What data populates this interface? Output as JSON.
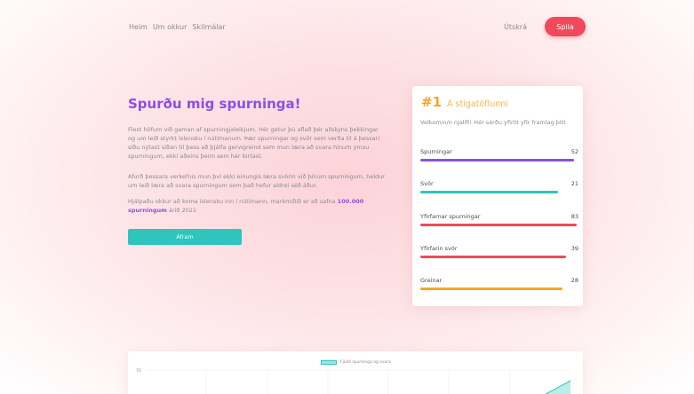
{
  "nav": {
    "items": [
      "Heim",
      "Um okkur",
      "Skilmálar"
    ],
    "logout": "Útskrá",
    "play": "Spila"
  },
  "hero": {
    "title": "Spurðu mig spurninga!",
    "p1": "Flest höfum við gaman af spurningjaleikjum. Hér getur þú aflað þér allskyns þekkingar og um leið styrkt íslensku í nútímanum. Þær spurningar og svör sem verða til á þessari síðu nýtast síðan til þess að þjálfa gervigreind sem mun læra að svara hinum ýmsu spurningum, ekki aðeins þeim sem hér birtast.",
    "p2": "Afurð þessara verkefnis mun því ekki einungis læra svörin við þínum spurningum, heldur um leið læra að svara spurningum sem það hefur aldrei séð áður.",
    "p3_pre": "Hjálpaðu okkur að koma íslensku inn í nútímann, markmiðið er að safna ",
    "p3_highlight": "100.000 spurningum",
    "p3_post": " árið 2021",
    "cta": "Áfram"
  },
  "leaderboard": {
    "rank": "#1",
    "title": "Á stigatöflunni",
    "welcome": "Velkomin/n njallfi! Hér sérðu yfirlit yfir framlag þitt",
    "stats": [
      {
        "label": "Spurningar",
        "value": "52",
        "color": "#8c4fe6",
        "fill": 0.97
      },
      {
        "label": "Svör",
        "value": "21",
        "color": "#2fc4bd",
        "fill": 0.87
      },
      {
        "label": "Yfirfarnar spurningar",
        "value": "83",
        "color": "#ee4a5e",
        "fill": 0.99
      },
      {
        "label": "Yfirfarin svör",
        "value": "39",
        "color": "#ee4a5e",
        "fill": 0.92
      },
      {
        "label": "Greinar",
        "value": "28",
        "color": "#f5a623",
        "fill": 0.9
      }
    ]
  },
  "chart": {
    "legend": "Fjöldi spurninga og svara",
    "ytick": "70",
    "accent": "#2fc4bd"
  }
}
